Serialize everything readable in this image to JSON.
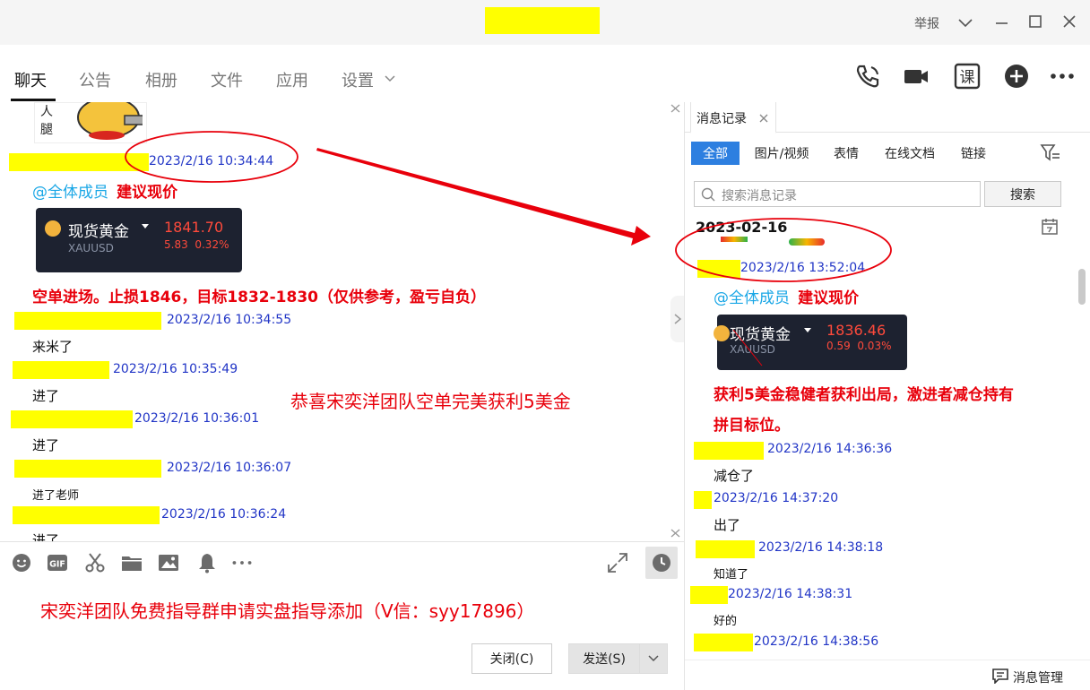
{
  "window": {
    "report_label": "举报",
    "min_icon": "minimize-icon",
    "max_icon": "maximize-icon",
    "close_icon": "close-icon"
  },
  "nav": {
    "tabs": [
      "聊天",
      "公告",
      "相册",
      "文件",
      "应用",
      "设置"
    ],
    "active": "聊天",
    "course_label": "课"
  },
  "chat": {
    "messages": [
      {
        "ts": "2023/2/16 10:34:44"
      },
      {
        "ts": "2023/2/16 10:34:55",
        "text": "来米了"
      },
      {
        "ts": "2023/2/16 10:35:49",
        "text": "进了"
      },
      {
        "ts": "2023/2/16 10:36:01",
        "text": "进了"
      },
      {
        "ts": "2023/2/16 10:36:07",
        "text": "进了老师"
      },
      {
        "ts": "2023/2/16 10:36:24",
        "text": "进了"
      }
    ],
    "sticker_text": "人腿",
    "mention": "@全体成员",
    "suggest": "建议现价",
    "quote": {
      "name": "现货黄金",
      "code": "XAUUSD",
      "price": "1841.70",
      "change": "5.83",
      "pct": "0.32%"
    },
    "signal": "空单进场。止损1846，目标1832-1830（仅供参考，盈亏自负）",
    "congrats_note": "恭喜宋奕洋团队空单完美获利5美金"
  },
  "input": {
    "text": "宋奕洋团队免费指导群申请实盘指导添加（V信：syy17896）",
    "close_btn": "关闭(C)",
    "send_btn": "发送(S)"
  },
  "history": {
    "tab_label": "消息记录",
    "filters": [
      "全部",
      "图片/视频",
      "表情",
      "在线文档",
      "链接"
    ],
    "search_placeholder": "搜索消息记录",
    "search_btn": "搜索",
    "date": "2023-02-16",
    "messages": [
      {
        "ts": "2023/2/16 13:52:04"
      },
      {
        "ts": "2023/2/16 14:36:36",
        "text": "减仓了"
      },
      {
        "ts": "2023/2/16 14:37:20",
        "text": "出了"
      },
      {
        "ts": "2023/2/16 14:38:18",
        "text": "知道了"
      },
      {
        "ts": "2023/2/16 14:38:31",
        "text": "好的"
      },
      {
        "ts": "2023/2/16 14:38:56"
      }
    ],
    "mention": "@全体成员",
    "suggest": "建议现价",
    "quote": {
      "name": "现货黄金",
      "code": "XAUUSD",
      "price": "1836.46",
      "change": "0.59",
      "pct": "0.03%"
    },
    "profit_line1": "获利5美金稳健者获利出局，激进者减仓持有",
    "profit_line2": "拼目标位。",
    "manage_label": "消息管理"
  },
  "colors": {
    "accent": "#2d7fe0",
    "alert": "#e8000b",
    "timestamp": "#2135c6",
    "mention": "#1aa7e6",
    "mask": "#ffff00"
  }
}
